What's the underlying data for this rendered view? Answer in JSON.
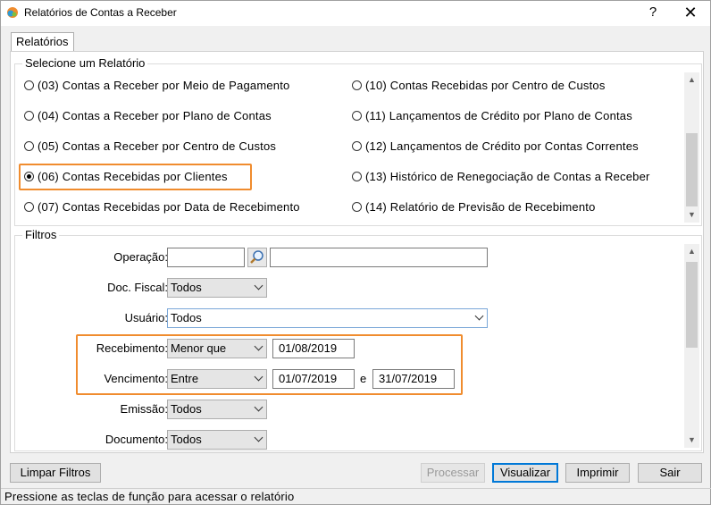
{
  "window": {
    "title": "Relatórios de Contas a Receber",
    "help_label": "?",
    "close_label": "✕"
  },
  "tab": {
    "label": "Relatórios"
  },
  "report_group": {
    "title": "Selecione um Relatório",
    "options": [
      "(03) Contas a Receber por Meio de Pagamento",
      "(04) Contas a Receber por Plano de Contas",
      "(05) Contas a Receber por Centro de Custos",
      "(06) Contas Recebidas por Clientes",
      "(07) Contas Recebidas por Data de Recebimento",
      "(10) Contas Recebidas por Centro de Custos",
      "(11) Lançamentos de Crédito por Plano de Contas",
      "(12) Lançamentos de Crédito por Contas Correntes",
      "(13) Histórico de Renegociação de Contas a Receber",
      "(14) Relatório de Previsão de Recebimento"
    ],
    "selected_index": 3
  },
  "filters": {
    "title": "Filtros",
    "operacao": {
      "label": "Operação:",
      "value": "",
      "desc": ""
    },
    "doc_fiscal": {
      "label": "Doc. Fiscal:",
      "value": "Todos"
    },
    "usuario": {
      "label": "Usuário:",
      "value": "Todos"
    },
    "recebimento": {
      "label": "Recebimento:",
      "operator": "Menor que",
      "date1": "01/08/2019"
    },
    "vencimento": {
      "label": "Vencimento:",
      "operator": "Entre",
      "date1": "01/07/2019",
      "conj": "e",
      "date2": "31/07/2019"
    },
    "emissao": {
      "label": "Emissão:",
      "value": "Todos"
    },
    "documento": {
      "label": "Documento:",
      "value": "Todos"
    }
  },
  "buttons": {
    "limpar": "Limpar Filtros",
    "processar": "Processar",
    "visualizar": "Visualizar",
    "imprimir": "Imprimir",
    "sair": "Sair"
  },
  "status": "Pressione as teclas de função para acessar o relatório",
  "colors": {
    "highlight": "#f08c2e",
    "accent": "#0078d7"
  }
}
